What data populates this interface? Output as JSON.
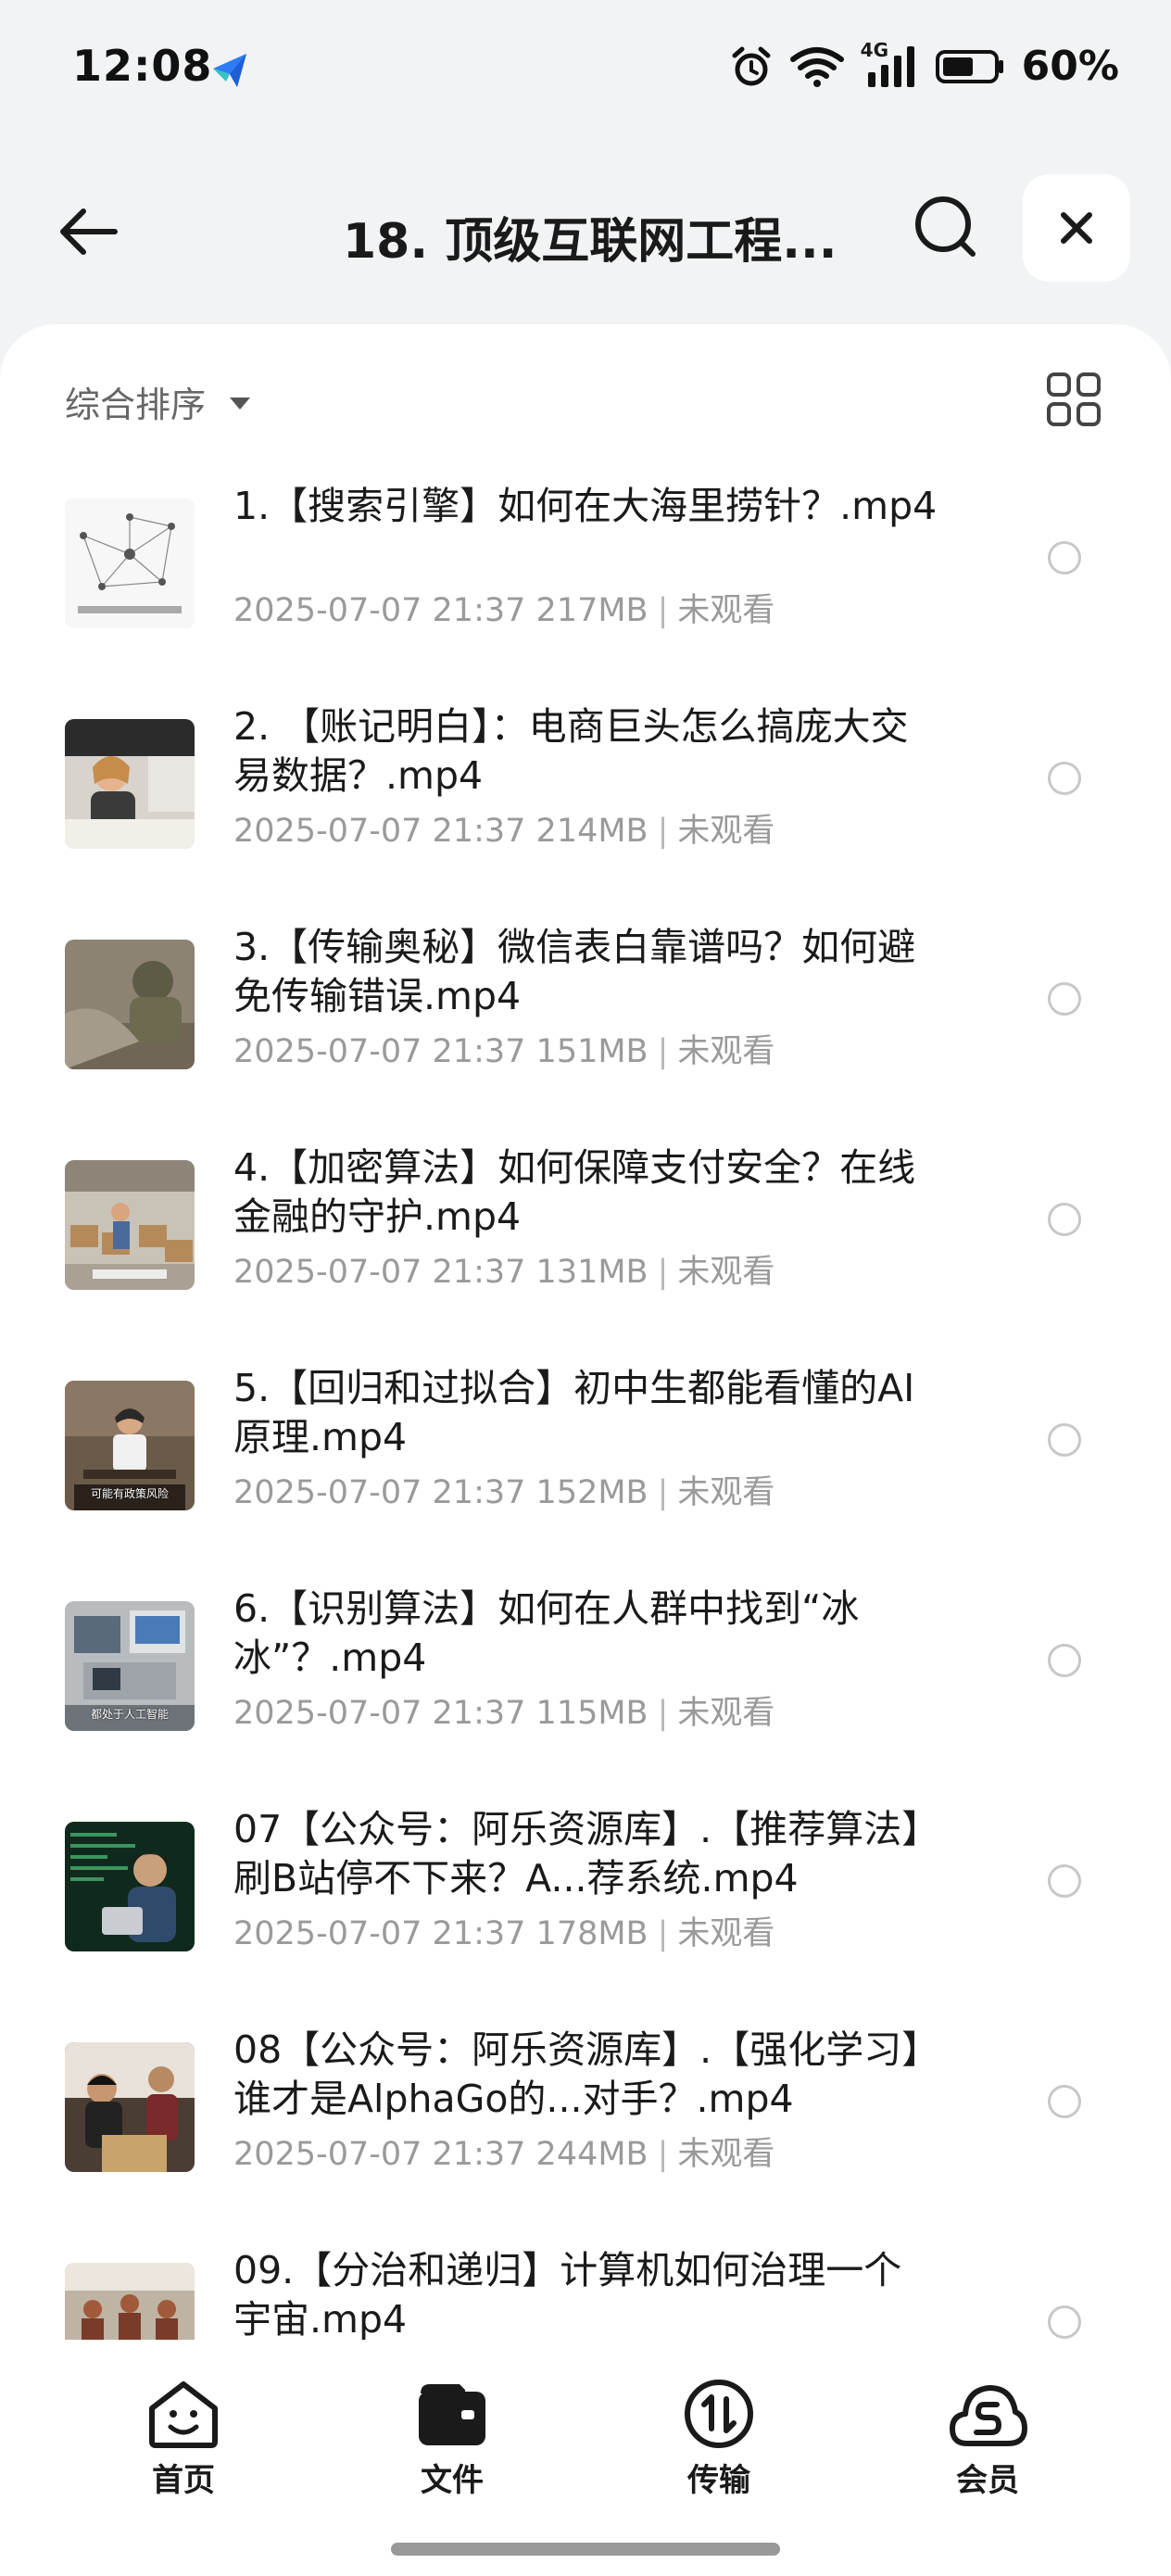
{
  "status": {
    "time": "12:08",
    "network": "4G",
    "battery": "60%"
  },
  "header": {
    "title": "18. 顶级互联网工程..."
  },
  "sort": {
    "label": "综合排序"
  },
  "files": [
    {
      "name": "1.【搜索引擎】如何在大海里捞针？.mp4",
      "date": "2025-07-07 21:37",
      "size": "217MB",
      "status": "未观看",
      "thumb": "network",
      "caption": ""
    },
    {
      "name": "2. 【账记明白】：电商巨头怎么搞庞大交易数据？.mp4",
      "date": "2025-07-07 21:37",
      "size": "214MB",
      "status": "未观看",
      "thumb": "office-woman",
      "caption": ""
    },
    {
      "name": "3.【传输奥秘】微信表白靠谱吗？如何避免传输错误.mp4",
      "date": "2025-07-07 21:37",
      "size": "151MB",
      "status": "未观看",
      "thumb": "soldier",
      "caption": ""
    },
    {
      "name": "4.【加密算法】如何保障支付安全？在线金融的守护.mp4",
      "date": "2025-07-07 21:37",
      "size": "131MB",
      "status": "未观看",
      "thumb": "warehouse",
      "caption": ""
    },
    {
      "name": "5.【回归和过拟合】初中生都能看懂的AI原理.mp4",
      "date": "2025-07-07 21:37",
      "size": "152MB",
      "status": "未观看",
      "thumb": "meeting",
      "caption": "可能有政策风险"
    },
    {
      "name": "6.【识别算法】如何在人群中找到“冰冰”？.mp4",
      "date": "2025-07-07 21:37",
      "size": "115MB",
      "status": "未观看",
      "thumb": "computers",
      "caption": "都处于人工智能"
    },
    {
      "name": "07【公众号：阿乐资源库】.【推荐算法】刷B站停不下来？A...荐系统.mp4",
      "date": "2025-07-07 21:37",
      "size": "178MB",
      "status": "未观看",
      "thumb": "code-man",
      "caption": ""
    },
    {
      "name": "08【公众号：阿乐资源库】.【强化学习】谁才是AlphaGo的...对手？.mp4",
      "date": "2025-07-07 21:37",
      "size": "244MB",
      "status": "未观看",
      "thumb": "go-game",
      "caption": ""
    },
    {
      "name": "09.【分治和递归】计算机如何治理一个宇宙.mp4",
      "date": "",
      "size": "",
      "status": "",
      "thumb": "classroom",
      "caption": ""
    }
  ],
  "nav": {
    "items": [
      {
        "label": "首页",
        "icon": "home-smile-icon"
      },
      {
        "label": "文件",
        "icon": "wallet-folder-icon"
      },
      {
        "label": "传输",
        "icon": "transfer-icon"
      },
      {
        "label": "会员",
        "icon": "vip-cloud-icon"
      }
    ]
  }
}
